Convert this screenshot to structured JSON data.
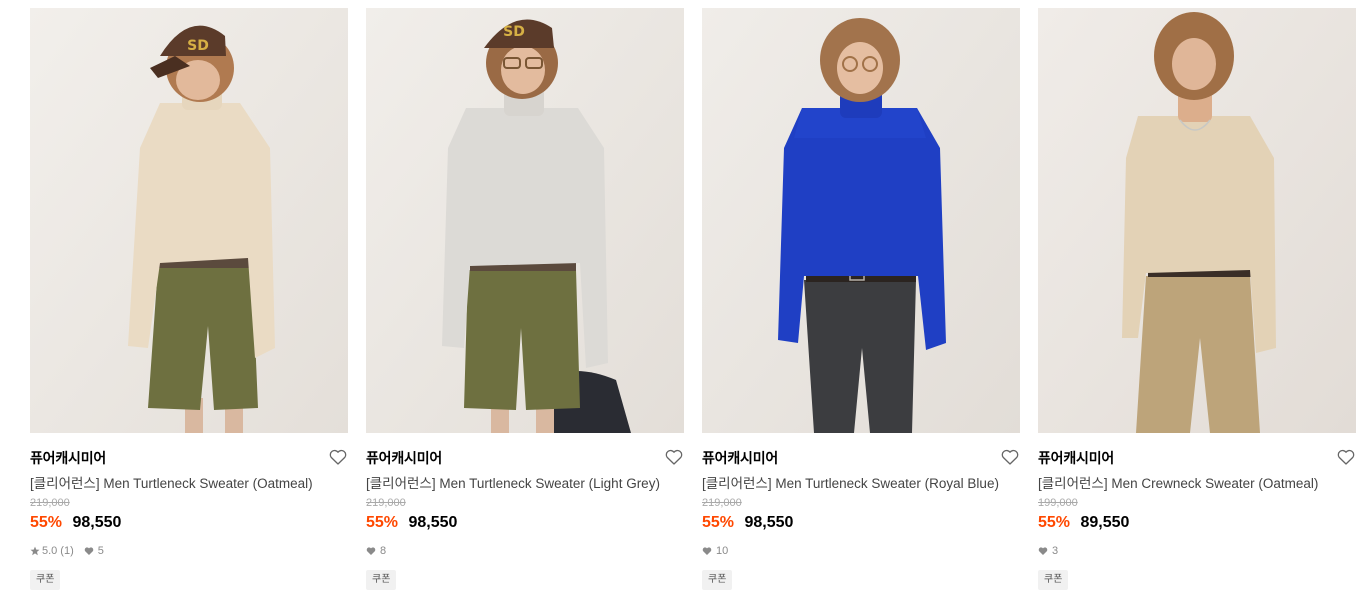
{
  "colors": {
    "discount": "#ff4800",
    "price": "#000000",
    "original_price": "#a9a9a9",
    "meta": "#8a8a8a",
    "coupon_bg": "#f1f1f1"
  },
  "products": [
    {
      "brand": "퓨어캐시미어",
      "name": "[클리어런스] Men Turtleneck Sweater (Oatmeal)",
      "original_price": "219,000",
      "discount": "55%",
      "price": "98,550",
      "rating": "5.0",
      "reviews": "(1)",
      "likes": "5",
      "coupon": "쿠폰",
      "image_icon": "model-photo-oatmeal-turtleneck"
    },
    {
      "brand": "퓨어캐시미어",
      "name": "[클리어런스] Men Turtleneck Sweater (Light Grey)",
      "original_price": "219,000",
      "discount": "55%",
      "price": "98,550",
      "likes": "8",
      "coupon": "쿠폰",
      "image_icon": "model-photo-grey-turtleneck"
    },
    {
      "brand": "퓨어캐시미어",
      "name": "[클리어런스] Men Turtleneck Sweater (Royal Blue)",
      "original_price": "219,000",
      "discount": "55%",
      "price": "98,550",
      "likes": "10",
      "coupon": "쿠폰",
      "image_icon": "model-photo-blue-turtleneck"
    },
    {
      "brand": "퓨어캐시미어",
      "name": "[클리어런스] Men Crewneck Sweater (Oatmeal)",
      "original_price": "199,000",
      "discount": "55%",
      "price": "89,550",
      "likes": "3",
      "coupon": "쿠폰",
      "image_icon": "model-photo-oatmeal-crewneck"
    }
  ]
}
